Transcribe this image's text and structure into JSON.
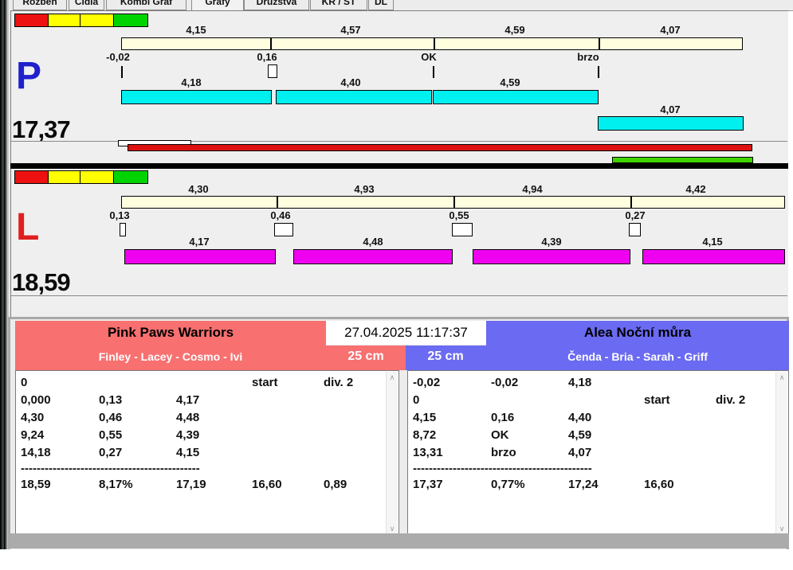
{
  "tabs": [
    "Rozběh",
    "Čidla",
    "Kombi Graf",
    "Grafy",
    "Družstva",
    "KR / ST",
    "DL"
  ],
  "active_tab": "Grafy",
  "icons": {
    "scroll_up": "∧",
    "scroll_down": "∨"
  },
  "lane_p": {
    "letter": "P",
    "total": "17,37",
    "splits_top": [
      "4,15",
      "4,57",
      "4,59",
      "4,07"
    ],
    "marks": [
      "-0,02",
      "0,16",
      "OK",
      "brzo"
    ],
    "splits_bottom": [
      "4,18",
      "4,40",
      "4,59",
      "4,07"
    ]
  },
  "lane_l": {
    "letter": "L",
    "total": "18,59",
    "splits_top": [
      "4,30",
      "4,93",
      "4,94",
      "4,42"
    ],
    "marks": [
      "0,13",
      "0,46",
      "0,55",
      "0,27"
    ],
    "splits_bottom": [
      "4,17",
      "4,48",
      "4,39",
      "4,15"
    ]
  },
  "scoreboard": {
    "datetime": "27.04.2025 11:17:37",
    "left": {
      "team": "Pink Paws Warriors",
      "dogs": "Finley - Lacey - Cosmo - Ivi",
      "height": "25 cm",
      "rows": [
        [
          "0",
          "",
          "",
          "start",
          "div. 2"
        ],
        [
          "0,000",
          "0,13",
          "4,17",
          "",
          ""
        ],
        [
          "4,30",
          "0,46",
          "4,48",
          "",
          ""
        ],
        [
          "9,24",
          "0,55",
          "4,39",
          "",
          ""
        ],
        [
          "14,18",
          "0,27",
          "4,15",
          "",
          ""
        ]
      ],
      "separator": "---------------------------------------------",
      "totals": [
        "18,59",
        "8,17%",
        "17,19",
        "16,60",
        "0,89"
      ]
    },
    "right": {
      "team": "Alea Noční můra",
      "dogs": "Čenda - Bria - Sarah - Griff",
      "height": "25 cm",
      "rows": [
        [
          "-0,02",
          "-0,02",
          "4,18",
          "",
          ""
        ],
        [
          "0",
          "",
          "",
          "start",
          "div. 2"
        ],
        [
          "4,15",
          "0,16",
          "4,40",
          "",
          ""
        ],
        [
          "8,72",
          "OK",
          "4,59",
          "",
          ""
        ],
        [
          "13,31",
          "brzo",
          "4,07",
          "",
          ""
        ]
      ],
      "separator": "---------------------------------------------",
      "totals": [
        "17,37",
        "0,77%",
        "17,24",
        "16,60",
        ""
      ]
    }
  },
  "colors": {
    "cream": "#FFFFE0",
    "cyan": "#00EFEF",
    "magenta": "#F000F0",
    "bar-red": "#DD1111",
    "bar-green": "#3FD400",
    "sq-red": "#EE1111",
    "sq-yellow": "#FFFF00",
    "sq-green": "#00D400",
    "lane-p": "#2020CC",
    "lane-l": "#E02020",
    "team-left": "#F87070",
    "team-right": "#6A6AF2",
    "footer": "#ABABAB"
  }
}
